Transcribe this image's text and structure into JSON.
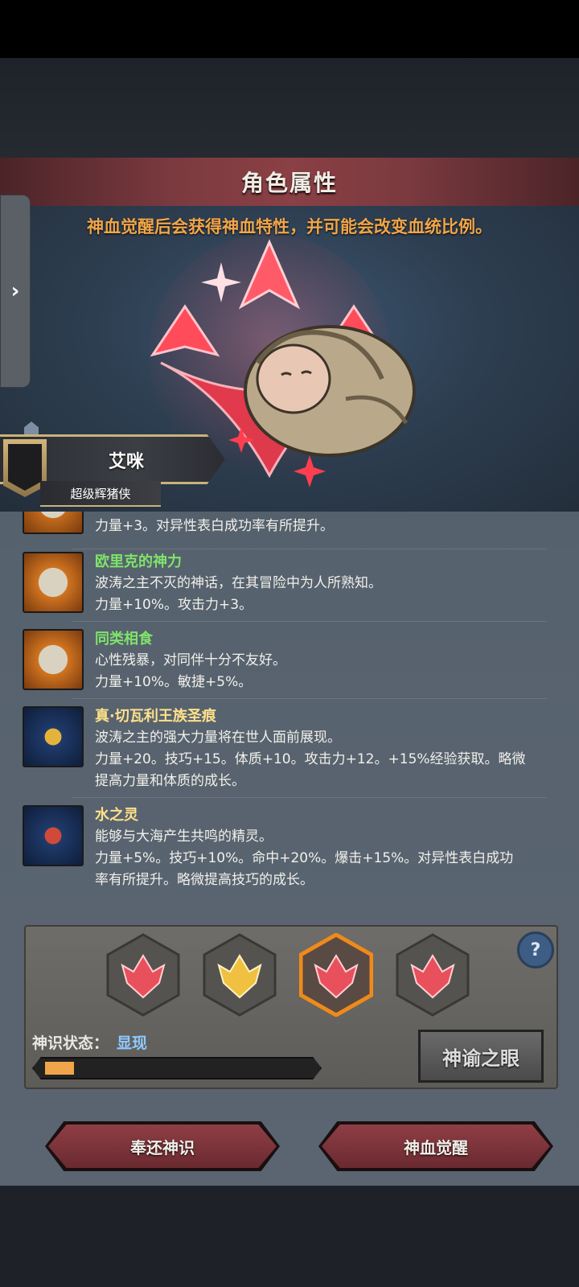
{
  "header": {
    "title": "角色属性"
  },
  "scene": {
    "caption": "神血觉醒后会获得神血特性，并可能会改变血统比例。"
  },
  "character": {
    "name": "艾咪",
    "title": "超级辉猪侠"
  },
  "traits": [
    {
      "name": "",
      "name_color": "#7fe36a",
      "desc": [
        "力量+3。对异性表白成功率有所提升。"
      ],
      "icon": "smiley-icon"
    },
    {
      "name": "欧里克的神力",
      "name_color": "#7fe36a",
      "desc": [
        "波涛之主不灭的神话，在其冒险中为人所熟知。",
        "力量+10%。攻击力+3。"
      ],
      "icon": "smiley-icon"
    },
    {
      "name": "同类相食",
      "name_color": "#7fe36a",
      "desc": [
        "心性残暴，对同伴十分不友好。",
        "力量+10%。敏捷+5%。"
      ],
      "icon": "smiley-icon"
    },
    {
      "name": "真·切瓦利王族圣痕",
      "name_color": "#ffe08a",
      "desc": [
        "波涛之主的强大力量将在世人面前展现。",
        "力量+20。技巧+15。体质+10。攻击力+12。+15%经验获取。略微",
        "提高力量和体质的成长。"
      ],
      "icon": "gold-scales-icon"
    },
    {
      "name": "水之灵",
      "name_color": "#ffe08a",
      "desc": [
        "能够与大海产生共鸣的精灵。",
        "力量+5%。技巧+10%。命中+20%。爆击+15%。对异性表白成功",
        "率有所提升。略微提高技巧的成长。"
      ],
      "icon": "red-scales-icon"
    }
  ],
  "awakening": {
    "slots": [
      {
        "color": "#e8505c",
        "selected": false
      },
      {
        "color": "#f0c040",
        "selected": false
      },
      {
        "color": "#e8505c",
        "selected": true
      },
      {
        "color": "#e8505c",
        "selected": false
      }
    ],
    "status_label": "神识状态：",
    "status_value": "显现",
    "progress": 0.11,
    "oracle_button": "神谕之眼",
    "help_icon": "?"
  },
  "actions": {
    "return_label": "奉还神识",
    "awaken_label": "神血觉醒"
  },
  "side_tab": {
    "icon": "chevron-right-icon",
    "glyph": "›"
  }
}
